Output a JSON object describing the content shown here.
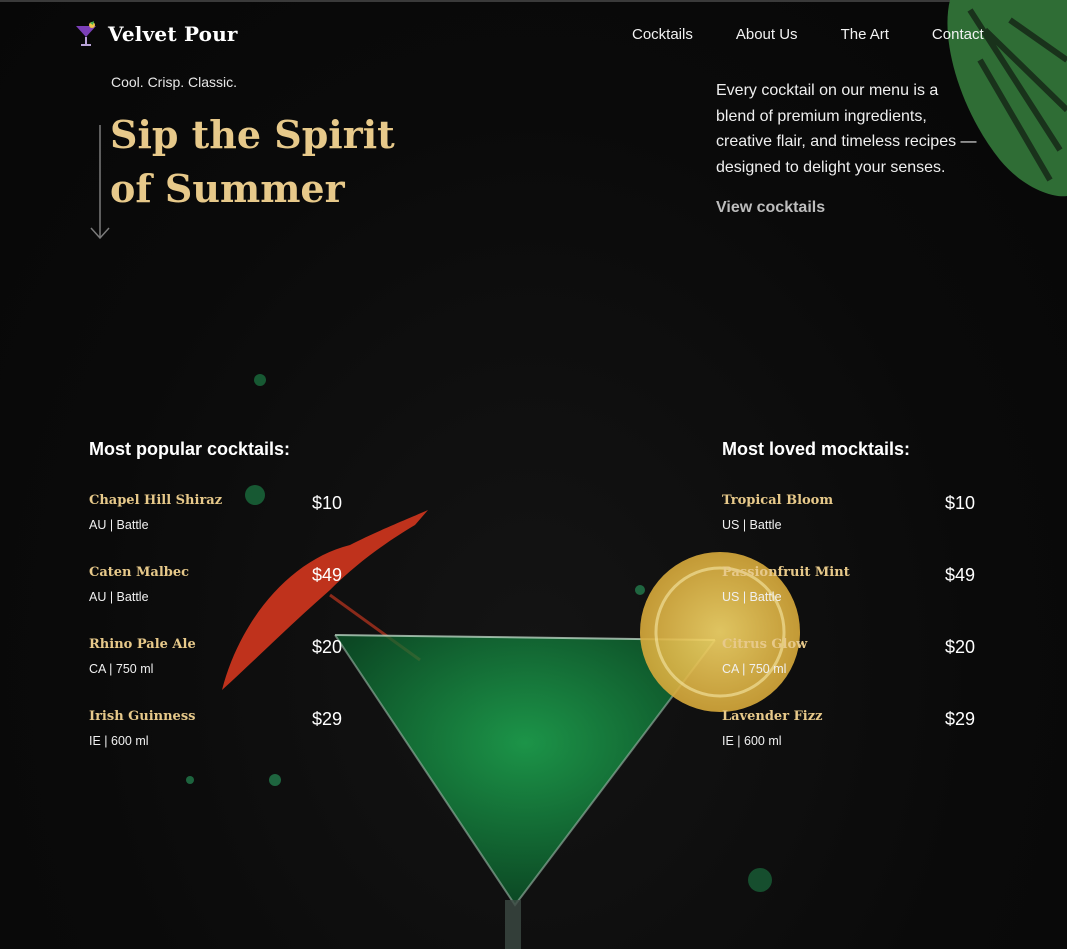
{
  "brand": {
    "name": "Velvet Pour",
    "icon": "cocktail-glass-icon"
  },
  "nav": {
    "items": [
      "Cocktails",
      "About Us",
      "The Art",
      "Contact"
    ]
  },
  "hero": {
    "tagline": "Cool. Crisp. Classic.",
    "title_line1": "Sip the Spirit",
    "title_line2": "of Summer",
    "description": "Every cocktail on our menu is a blend of premium ingredients, creative flair, and timeless recipes — designed to delight your senses.",
    "cta": "View cocktails"
  },
  "cocktails": {
    "heading": "Most popular cocktails:",
    "items": [
      {
        "name": "Chapel Hill Shiraz",
        "meta": "AU | Battle",
        "price": "$10"
      },
      {
        "name": "Caten Malbec",
        "meta": "AU | Battle",
        "price": "$49"
      },
      {
        "name": "Rhino Pale Ale",
        "meta": "CA | 750 ml",
        "price": "$20"
      },
      {
        "name": "Irish Guinness",
        "meta": "IE | 600 ml",
        "price": "$29"
      }
    ]
  },
  "mocktails": {
    "heading": "Most loved mocktails:",
    "items": [
      {
        "name": "Tropical Bloom",
        "meta": "US | Battle",
        "price": "$10"
      },
      {
        "name": "Passionfruit Mint",
        "meta": "US | Battle",
        "price": "$49"
      },
      {
        "name": "Citrus Glow",
        "meta": "CA | 750 ml",
        "price": "$20"
      },
      {
        "name": "Lavender Fizz",
        "meta": "IE | 600 ml",
        "price": "$29"
      }
    ]
  },
  "colors": {
    "accent": "#e7c98a",
    "background": "#0b0b0b",
    "text": "#ffffff"
  }
}
